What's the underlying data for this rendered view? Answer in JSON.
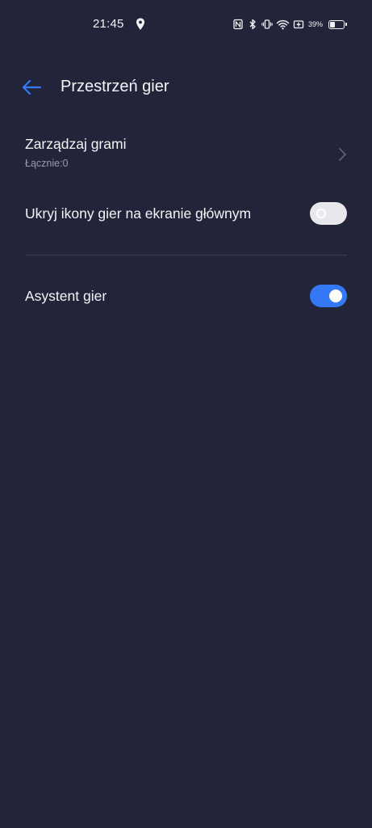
{
  "status_bar": {
    "time": "21:45",
    "battery_percent": "39%",
    "battery_level": 0.39,
    "icons": [
      "location-icon",
      "nfc-icon",
      "bluetooth-icon",
      "vibrate-icon",
      "wifi-icon",
      "battery-saver-icon",
      "battery-icon"
    ]
  },
  "header": {
    "title": "Przestrzeń gier",
    "back_icon": "back-arrow-icon"
  },
  "settings": {
    "manage_games": {
      "title": "Zarządzaj grami",
      "subtitle": "Łącznie:0"
    },
    "hide_icons": {
      "title": "Ukryj ikony gier na ekranie głównym",
      "enabled": false
    },
    "game_assistant": {
      "title": "Asystent gier",
      "enabled": true
    }
  },
  "colors": {
    "background": "#22253a",
    "accent": "#3478f6",
    "toggle_off": "#e8e8ec",
    "divider": "#3b3e52"
  }
}
